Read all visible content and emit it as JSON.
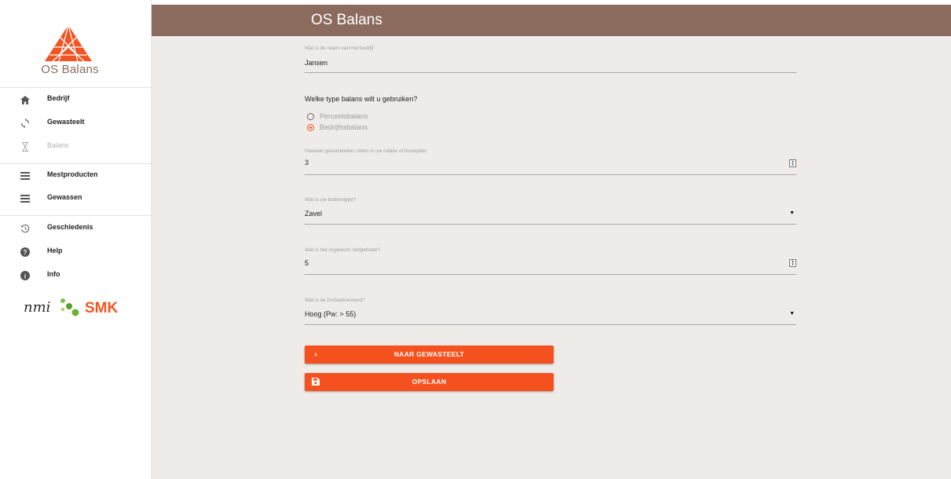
{
  "app": {
    "title": "OS Balans",
    "logo_text": "OS Balans",
    "accent_color": "#f4511e",
    "header_color": "#8b6b5d"
  },
  "sidebar": {
    "items": [
      {
        "label": "Bedrijf",
        "icon": "home-icon"
      },
      {
        "label": "Gewasteelt",
        "icon": "sync-icon"
      },
      {
        "label": "Balans",
        "icon": "hourglass-icon",
        "disabled": true
      },
      {
        "label": "Mestproducten",
        "icon": "list-icon"
      },
      {
        "label": "Gewassen",
        "icon": "list-icon"
      },
      {
        "label": "Geschiedenis",
        "icon": "history-icon"
      },
      {
        "label": "Help",
        "icon": "help-icon"
      },
      {
        "label": "Info",
        "icon": "info-icon"
      }
    ],
    "partners": {
      "nmi": "nmi",
      "smk": "SMK"
    }
  },
  "form": {
    "company_name": {
      "label": "Wat is de naam van het bedrijf",
      "value": "Jansen"
    },
    "balance_type": {
      "question": "Welke type balans wilt u gebruiken?",
      "options": [
        {
          "label": "Perceelsbalans",
          "checked": false
        },
        {
          "label": "Bedrijfssbalans",
          "checked": true
        }
      ]
    },
    "crops_count": {
      "label": "Hoeveel gewasteelten zitten in uw rotatie of bouwplan",
      "value": "3"
    },
    "soil_type": {
      "label": "Wat is uw bodemtype?",
      "value": "Zavel"
    },
    "organic_matter": {
      "label": "Wat is het organisch stofgehalte?",
      "value": "5"
    },
    "phosphate": {
      "label": "Wat is de fosfaattoestand?",
      "value": "Hoog (Pw: > 55)"
    }
  },
  "buttons": {
    "next_label": "NAAR GEWASTEELT",
    "save_label": "OPSLAAN"
  }
}
